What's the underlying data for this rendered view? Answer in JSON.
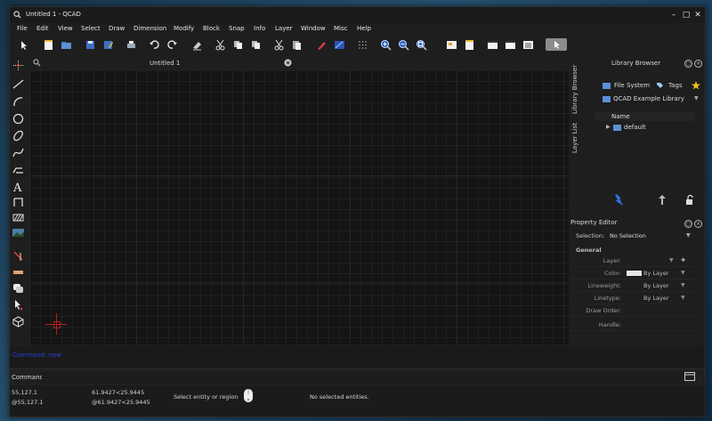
{
  "window": {
    "title": "Untitled 1 - QCAD"
  },
  "window_controls": {
    "minimize": "–",
    "maximize": "□",
    "close": "✕"
  },
  "menu": [
    "File",
    "Edit",
    "View",
    "Select",
    "Draw",
    "Dimension",
    "Modify",
    "Block",
    "Snap",
    "Info",
    "Layer",
    "Window",
    "Misc",
    "Help"
  ],
  "document_tab": {
    "label": "Untitled 1"
  },
  "library_browser": {
    "title": "Library Browser",
    "tab_file_system": "File System",
    "tab_tags": "Tags",
    "source": "QCAD Example Library",
    "column_name": "Name",
    "items": [
      "default"
    ]
  },
  "vertical_tabs": [
    "Library Browser",
    "Layer List"
  ],
  "property_editor": {
    "title": "Property Editor",
    "selection_label": "Selection:",
    "selection_value": "No Selection",
    "section": "General",
    "rows": [
      {
        "key": "Layer:",
        "value": ""
      },
      {
        "key": "Color:",
        "value": "By Layer"
      },
      {
        "key": "Lineweight:",
        "value": "By Layer"
      },
      {
        "key": "Linetype:",
        "value": "By Layer"
      },
      {
        "key": "Draw Order:",
        "value": ""
      },
      {
        "key": "Handle:",
        "value": ""
      }
    ]
  },
  "history": {
    "text": "Command: new"
  },
  "command": {
    "label": "Command:",
    "value": ""
  },
  "statusbar": {
    "abs_coord": "55,127.1",
    "rel_coord": "@55,127.1",
    "polar_abs": "61.9427<25.9445",
    "polar_rel": "@61.9427<25.9445",
    "hint": "Select entity or region",
    "selection": "No selected entities."
  },
  "colors": {
    "background": "#1e1e1e",
    "canvas": "#141414",
    "grid": "#202020",
    "crosshair": "#b51d1d",
    "history_text": "#2a3fd9",
    "accent_blue": "#3a6fd8"
  }
}
